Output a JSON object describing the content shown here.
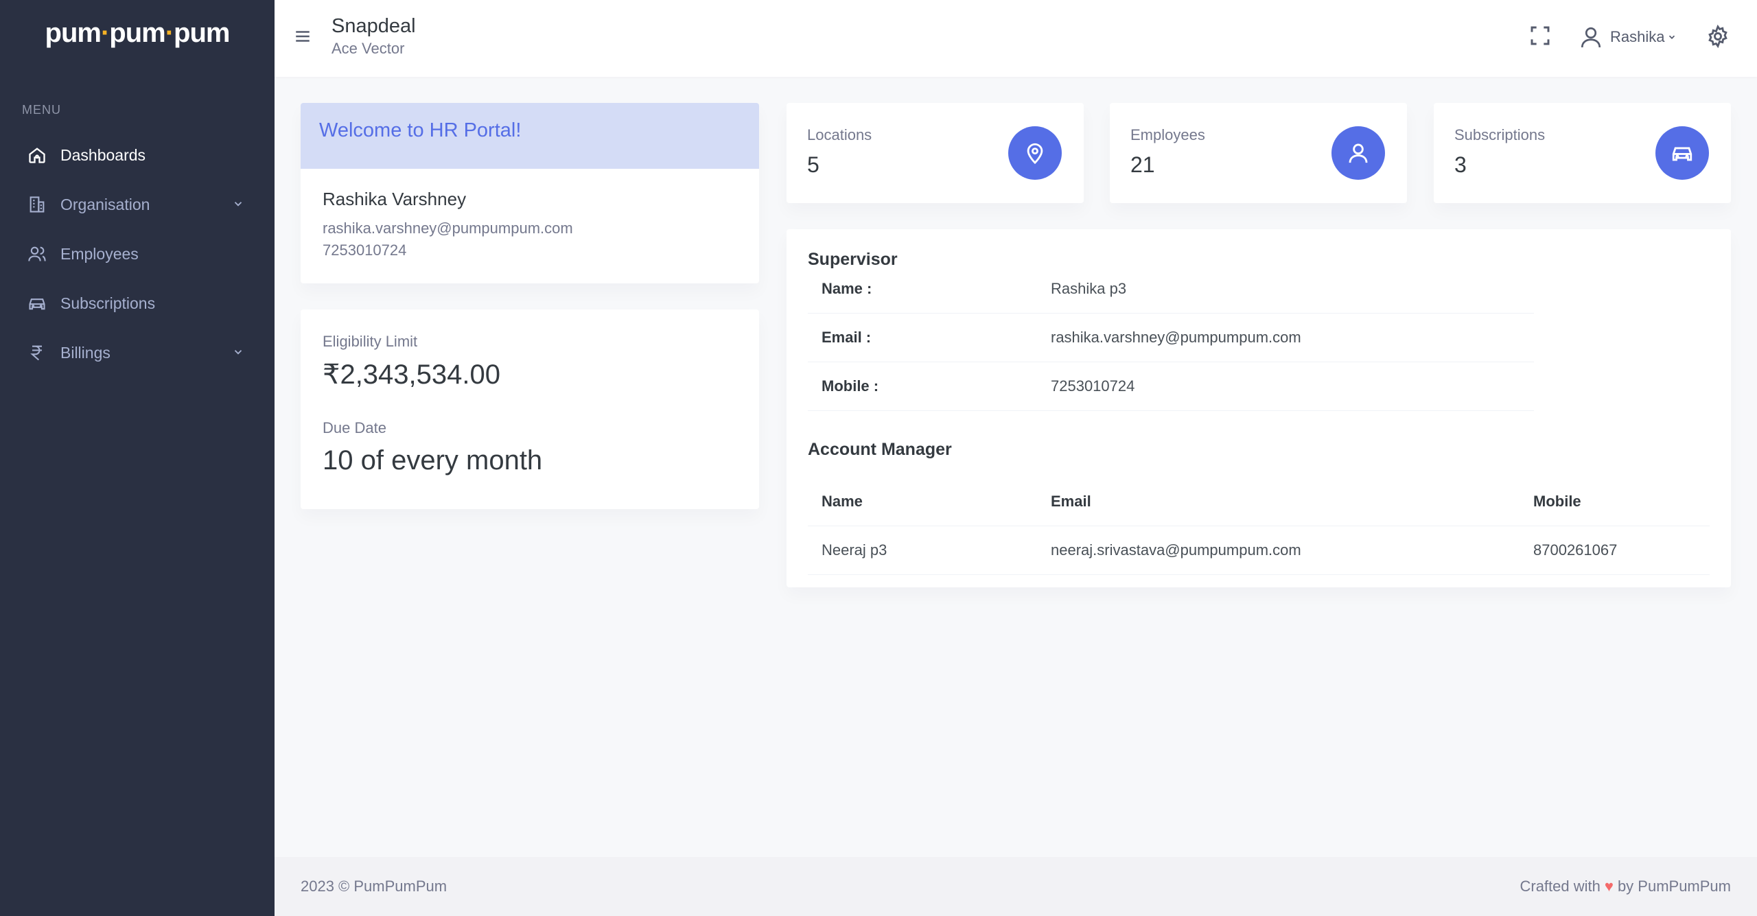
{
  "sidebar": {
    "logo": {
      "part1": "pum",
      "part2": "pum",
      "part3": "pum"
    },
    "menu_title": "MENU",
    "items": [
      {
        "label": "Dashboards",
        "icon": "home-icon",
        "active": true
      },
      {
        "label": "Organisation",
        "icon": "building-icon",
        "has_children": true
      },
      {
        "label": "Employees",
        "icon": "users-icon"
      },
      {
        "label": "Subscriptions",
        "icon": "car-icon"
      },
      {
        "label": "Billings",
        "icon": "rupee-icon",
        "has_children": true
      }
    ]
  },
  "header": {
    "title": "Snapdeal",
    "subtitle": "Ace Vector",
    "user_name": "Rashika"
  },
  "welcome": {
    "banner": "Welcome to HR Portal!",
    "name": "Rashika Varshney",
    "email": "rashika.varshney@pumpumpum.com",
    "phone": "7253010724"
  },
  "limit": {
    "eligibility_label": "Eligibility Limit",
    "eligibility_value": "₹2,343,534.00",
    "due_label": "Due Date",
    "due_value": "10 of every month"
  },
  "stats": [
    {
      "label": "Locations",
      "value": "5",
      "icon": "map-pin-icon"
    },
    {
      "label": "Employees",
      "value": "21",
      "icon": "user-icon"
    },
    {
      "label": "Subscriptions",
      "value": "3",
      "icon": "car-icon"
    }
  ],
  "supervisor": {
    "title": "Supervisor",
    "rows": [
      {
        "key": "Name :",
        "value": "Rashika p3"
      },
      {
        "key": "Email :",
        "value": "rashika.varshney@pumpumpum.com"
      },
      {
        "key": "Mobile :",
        "value": "7253010724"
      }
    ]
  },
  "account_manager": {
    "title": "Account Manager",
    "headers": [
      "Name",
      "Email",
      "Mobile"
    ],
    "row": [
      "Neeraj p3",
      "neeraj.srivastava@pumpumpum.com",
      "8700261067"
    ]
  },
  "footer": {
    "left": "2023 © PumPumPum",
    "right_prefix": "Crafted with",
    "right_suffix": "by PumPumPum"
  },
  "colors": {
    "sidebar_bg": "#2a3042",
    "accent": "#556ee6",
    "banner_bg": "#d4dcf6",
    "logo_dot": "#f5b225",
    "heart": "#f46a6a"
  }
}
